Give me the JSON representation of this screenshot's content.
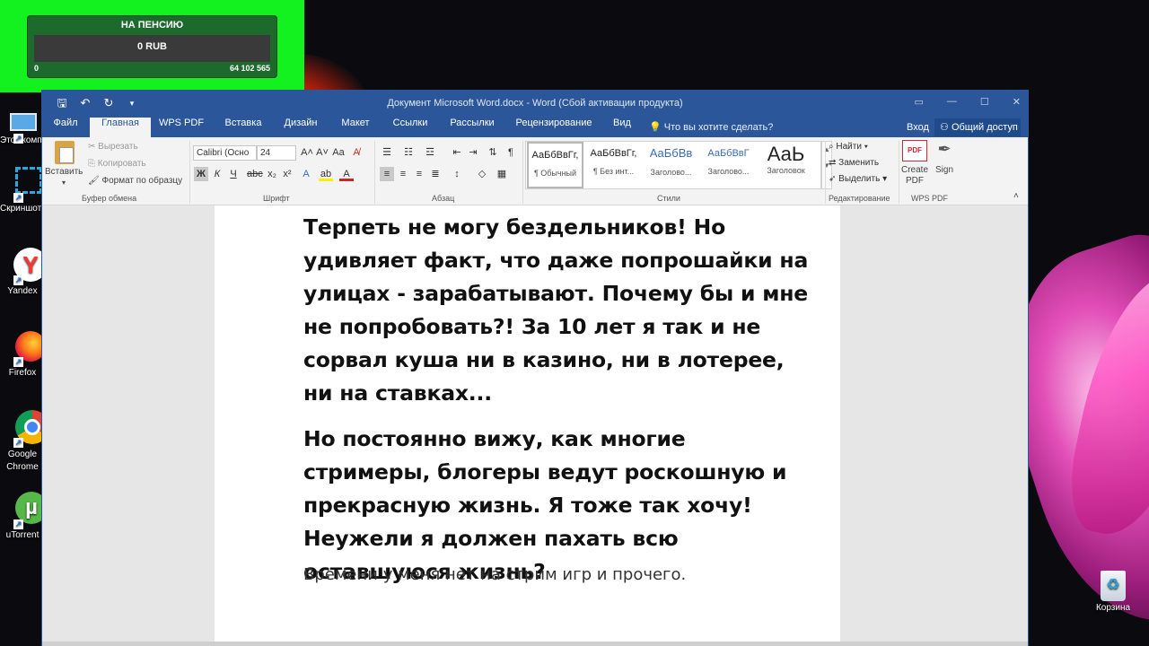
{
  "overlay": {
    "title": "НА ПЕНСИЮ",
    "amount": "0 RUB",
    "min": "0",
    "max": "64 102 565"
  },
  "desktop": {
    "icons": [
      {
        "label": "Этот компьютер",
        "icon": "computer-icon"
      },
      {
        "label": "Скриншоты",
        "icon": "screenshot-icon"
      },
      {
        "label": "Yandex",
        "icon": "yandex-icon"
      },
      {
        "label": "Firefox",
        "icon": "firefox-icon"
      },
      {
        "label": "Google Chrome",
        "icon": "chrome-icon"
      },
      {
        "label": "uTorrent",
        "icon": "utorrent-icon"
      }
    ],
    "recycle_bin": "Корзина"
  },
  "word": {
    "title": "Документ Microsoft Word.docx - Word (Сбой активации продукта)",
    "tabs": [
      "Файл",
      "Главная",
      "WPS PDF",
      "Вставка",
      "Дизайн",
      "Макет",
      "Ссылки",
      "Рассылки",
      "Рецензирование",
      "Вид"
    ],
    "active_tab": "Главная",
    "tell_me": "Что вы хотите сделать?",
    "sign_in": "Вход",
    "share": "Общий доступ",
    "clipboard": {
      "paste": "Вставить",
      "cut": "Вырезать",
      "copy": "Копировать",
      "format_painter": "Формат по образцу",
      "group": "Буфер обмена"
    },
    "font": {
      "name": "Calibri (Осно",
      "size": "24",
      "group": "Шрифт",
      "bold": "Ж",
      "italic": "К",
      "underline": "Ч"
    },
    "paragraph_group": "Абзац",
    "styles": {
      "items": [
        {
          "sample": "АаБбВвГг,",
          "name": "¶ Обычный"
        },
        {
          "sample": "АаБбВвГг,",
          "name": "¶ Без инт..."
        },
        {
          "sample": "АаБбВв",
          "name": "Заголово..."
        },
        {
          "sample": "АаБбВвГ",
          "name": "Заголово..."
        },
        {
          "sample": "АаЬ",
          "name": "Заголовок"
        }
      ],
      "group": "Стили"
    },
    "editing": {
      "find": "Найти",
      "replace": "Заменить",
      "select": "Выделить",
      "group": "Редактирование"
    },
    "wps": {
      "create": "Create PDF",
      "sign": "Sign",
      "group": "WPS PDF"
    },
    "document": {
      "p1": "Терпеть не могу бездельников! Но удивляет факт, что даже попрошайки на улицах - зарабатывают. Почему бы и мне не попробовать?! За 10 лет я так и не сорвал куша ни в казино, ни в лотерее, ни на ставках...",
      "p2": "Но постоянно вижу, как многие стримеры, блогеры ведут роскошную и прекрасную жизнь. Я тоже так хочу! Неужели я должен пахать всю оставшуюся жизнь?",
      "p3": "Времени у меня нет на стрим игр и прочего."
    }
  }
}
